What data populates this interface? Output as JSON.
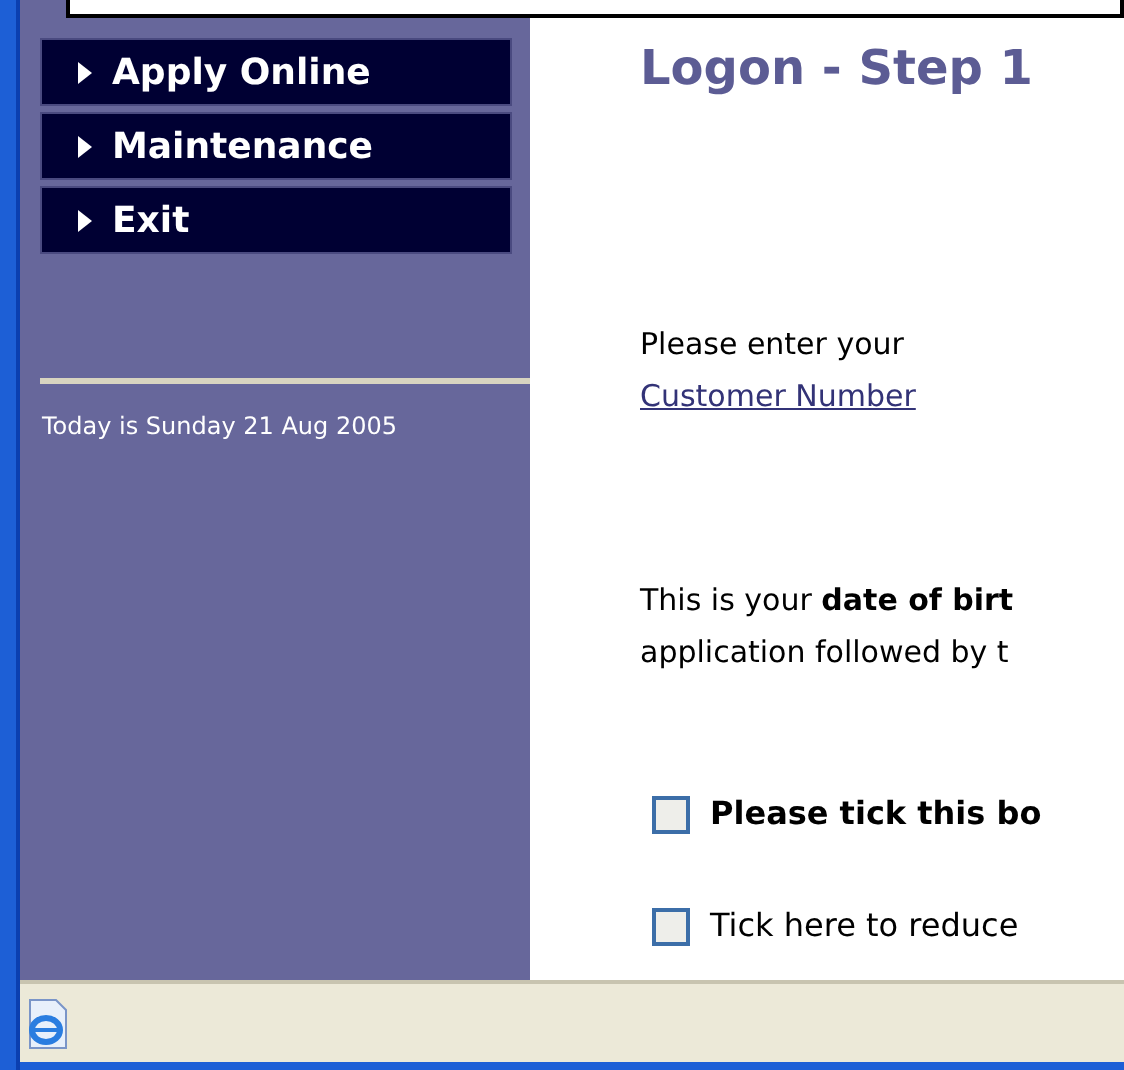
{
  "sidebar": {
    "menu": [
      {
        "label": "Apply Online"
      },
      {
        "label": "Maintenance"
      },
      {
        "label": "Exit"
      }
    ],
    "date": "Today is Sunday 21 Aug 2005"
  },
  "main": {
    "title": "Logon - Step 1",
    "prompt": "Please enter your",
    "link": "Customer Number",
    "info_lines": [
      "This is your **date of birt**",
      "application followed by t"
    ],
    "checkboxes": [
      {
        "kind": "bold",
        "label": "Please tick this bo",
        "checked": false
      },
      {
        "kind": "plain",
        "label": "Tick here to reduce",
        "checked": false
      }
    ]
  }
}
